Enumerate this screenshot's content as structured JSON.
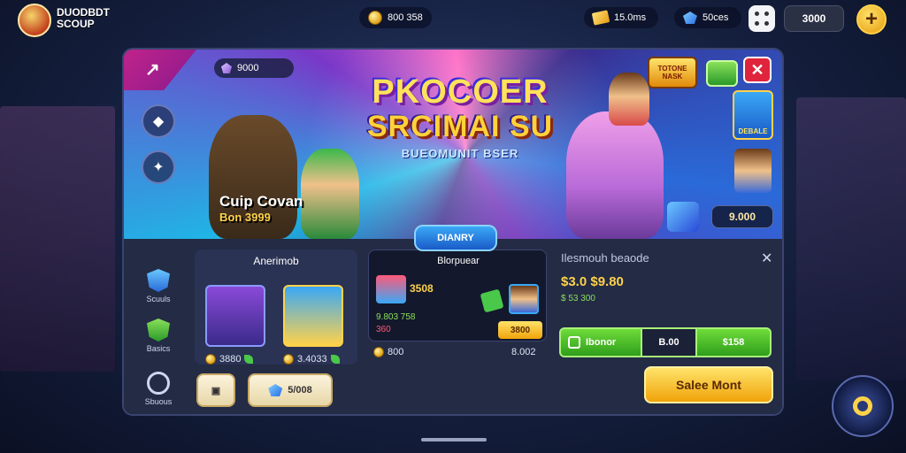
{
  "header": {
    "logo_text_line1": "DUODBDT",
    "logo_text_line2": "SCOUP",
    "coins": "800 358",
    "tickets": "15.0ms",
    "gems": "50ces",
    "total": "3000",
    "add_label": "+"
  },
  "banner": {
    "gem_pill": "9000",
    "title_line1": "PKOCOER",
    "title_line2": "SRCIMAI SU",
    "title_line3": "BUEOMUNIT BSER",
    "cup_text": "Cuip Covan",
    "cup_sub": "Bon 3999",
    "top_right_badge": "TOTONE NASK",
    "right_badge": "DEBALE",
    "score": "9.000",
    "close_label": "✕",
    "button_label": "DIANRY"
  },
  "sidebar": {
    "items": [
      {
        "label": "Scuuls",
        "icon": "shield-icon"
      },
      {
        "label": "Basics",
        "icon": "leaf-icon"
      },
      {
        "label": "Sbuous",
        "icon": "target-icon"
      }
    ]
  },
  "cards": {
    "section_title": "Anerimob",
    "card1_value": "3880",
    "card2_value": "3.4033",
    "gem_button": "5/008"
  },
  "offer": {
    "title": "Blorpuear",
    "line1": "3508",
    "line2": "9.803 758",
    "line3": "360",
    "bottom_left": "800",
    "bottom_right": "8.002",
    "tag_text": "3800"
  },
  "info": {
    "title": "Ilesmouh beaode",
    "close_label": "✕",
    "price_main": "$3.0 $9.80",
    "price_sub": "$ 53 300",
    "bar_left": "Ibonor",
    "bar_mid": "B.00",
    "bar_right": "$158",
    "sale_button": "Salee Mont"
  },
  "colors": {
    "accent_gold": "#ffd24a",
    "accent_green": "#4ac84a",
    "accent_red": "#e0243c",
    "panel_bg": "#232b45"
  }
}
